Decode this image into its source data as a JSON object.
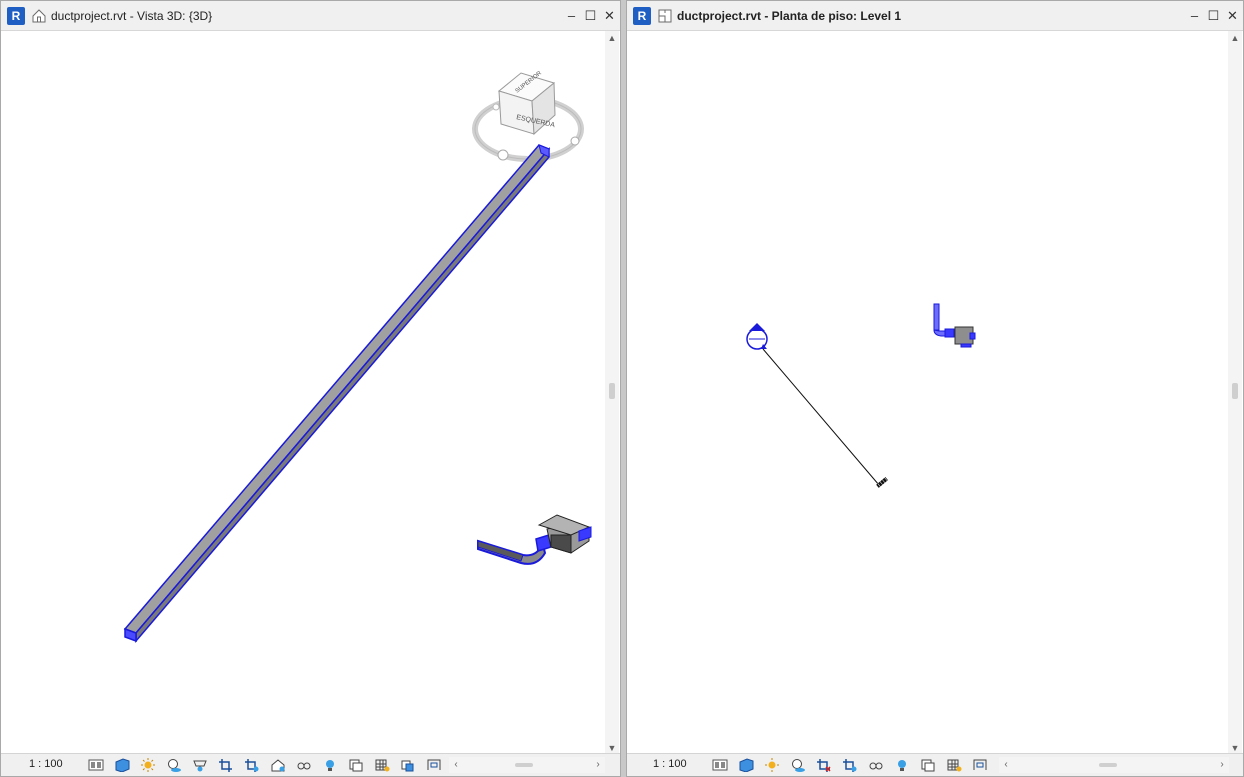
{
  "left_window": {
    "app_icon": "R",
    "view_icon": "house-3d-icon",
    "title": "ductproject.rvt - Vista 3D: {3D}",
    "viewcube": {
      "left_face": "ESQUERDA",
      "top_face": "SUPERIOR"
    },
    "scale": "1 : 100"
  },
  "right_window": {
    "app_icon": "R",
    "view_icon": "floor-plan-icon",
    "title": "ductproject.rvt - Planta de piso: Level 1",
    "scale": "1 : 100"
  },
  "window_buttons": {
    "minimize": "–",
    "restore": "☐",
    "close": "✕"
  },
  "scroll_arrows": {
    "up": "▲",
    "down": "▼",
    "left": "‹",
    "right": "›"
  },
  "colors": {
    "duct_edge": "#1a1adb",
    "duct_fill": "#8e8e8e",
    "revit_blue": "#1f5fc4"
  }
}
